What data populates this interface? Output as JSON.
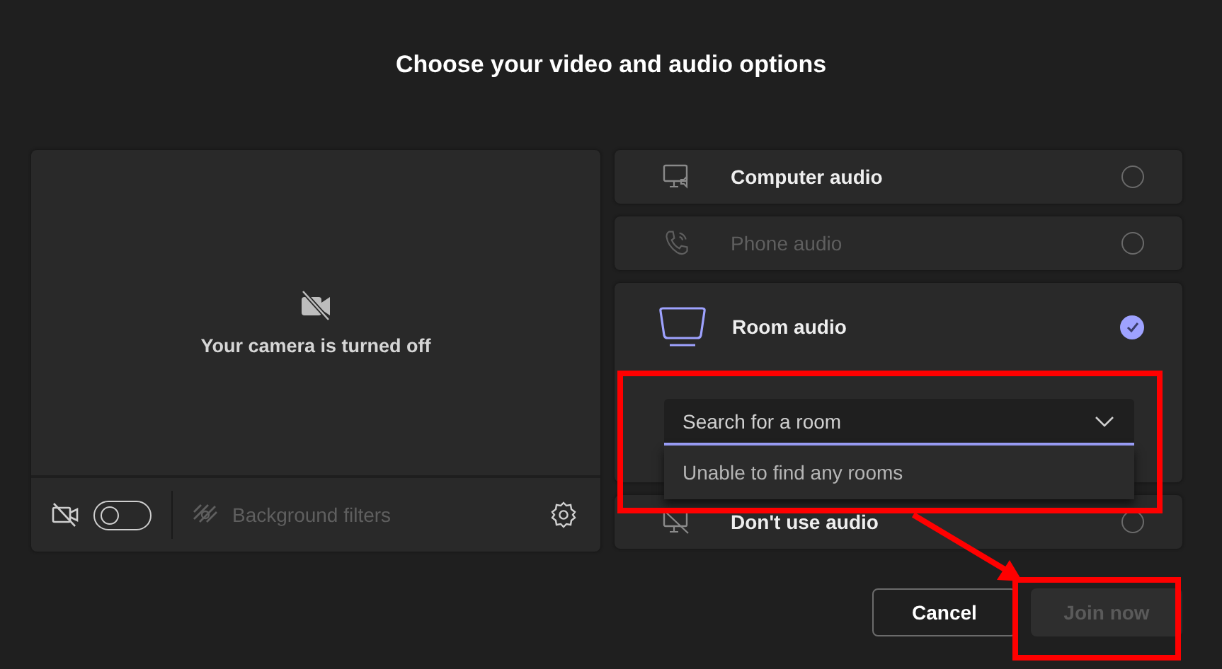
{
  "title": "Choose your video and audio options",
  "preview": {
    "message": "Your camera is turned off",
    "camera_on": false,
    "background_filters": {
      "label": "Background filters",
      "disabled": true
    }
  },
  "audio_options": [
    {
      "kind": "computer",
      "label": "Computer audio",
      "selected": false,
      "disabled": false
    },
    {
      "kind": "phone",
      "label": "Phone audio",
      "selected": false,
      "disabled": true
    },
    {
      "kind": "room",
      "label": "Room audio",
      "selected": true,
      "disabled": false,
      "search": {
        "placeholder": "Search for a room",
        "results_message": "Unable to find any rooms"
      }
    },
    {
      "kind": "none",
      "label": "Don't use audio",
      "selected": false,
      "disabled": false
    }
  ],
  "buttons": [
    {
      "label": "Cancel",
      "kind": "secondary",
      "disabled": false
    },
    {
      "label": "Join now",
      "kind": "primary",
      "disabled": true
    }
  ]
}
